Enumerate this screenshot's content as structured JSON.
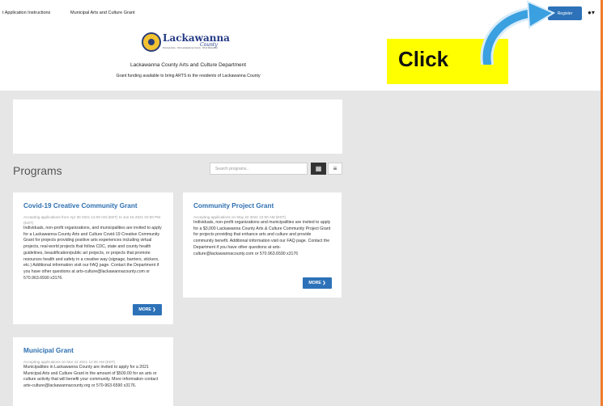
{
  "nav": {
    "links": [
      "t Application Instructions",
      "Municipal Arts and Culture Grant"
    ],
    "register": "Register",
    "help_icon": "gear-icon",
    "help_caret": "▾"
  },
  "logo": {
    "word": "Lackawanna",
    "script": "County",
    "tagline": "Pennsylvania · Visit Lackawanna County · Work Relocation"
  },
  "header": {
    "title": "Lackawanna County Arts and Culture Department",
    "subtitle": "Grant funding available to bring ARTS to the residents of Lackawanna County"
  },
  "overlay": {
    "text": "Click",
    "box_color": "#ffff00",
    "arrow_color": "#3aa0e0"
  },
  "programs": {
    "heading": "Programs",
    "search_placeholder": "Search programs..",
    "grid_icon": "grid-icon",
    "list_icon": "list-icon"
  },
  "cards": [
    {
      "title": "Covid-19 Creative Community Grant",
      "accept": "Accepting applications from Apr 30 2021 12:00 AM (EDT) to Jun 16 2021 02:00 PM (EDT)",
      "desc": "Individuals, non-profit organizations, and municipalities are invited to apply for a Lackawanna County Arts and Culture Covid-19 Creative Community Grant for projects providing positive arts experiences including virtual projects, real-world projects that follow CDC, state and county health guidelines, beautification/public art projects, or projects that promote resources health and safety in a creative way (signage, barriers, stickers, etc.) Additional information visit our FAQ page. Contact the Department if you have other questions at arts-culture@lackawannacounty.com or 570.963.6590 x3176.",
      "more": "MORE ❯"
    },
    {
      "title": "Community Project Grant",
      "accept": "Accepting applications on May 22 2021 12:00 AM (EDT)",
      "desc": "Individuals, non-profit organizations and municipalities are invited to apply for a $3,000 Lackawanna County Arts & Culture Community Project Grant for projects providing that enhance arts and culture and provide community benefit. Additional information visit our FAQ page. Contact the Department if you have other questions at arts-culture@lackawannacounty.com or 570.963.6590 x3176",
      "more": "MORE ❯"
    },
    {
      "title": "Municipal Grant",
      "accept": "Accepting applications on Mar 22 2021 12:00 AM (EDT)",
      "desc": "Municipalities in Lackawanna County are invited to apply for a 2021 Municipal Arts and Culture Grant in the amount of $500.00 for an arts or culture activity that will benefit your community. More information contact arts-culture@lackawannacounty.org or 570-963-6590 x3176."
    }
  ]
}
